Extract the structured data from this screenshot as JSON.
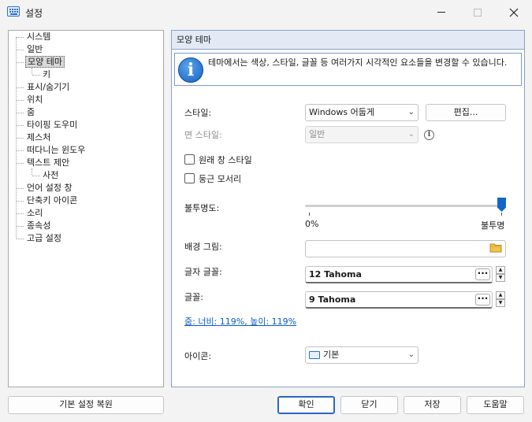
{
  "window": {
    "title": "설정"
  },
  "tree": {
    "items": [
      {
        "label": "시스템"
      },
      {
        "label": "일반"
      },
      {
        "label": "모양 테마",
        "selected": true
      },
      {
        "label": "키"
      },
      {
        "label": "표시/숨기기"
      },
      {
        "label": "위치"
      },
      {
        "label": "줌"
      },
      {
        "label": "타이핑 도우미"
      },
      {
        "label": "제스처"
      },
      {
        "label": "떠다니는 윈도우"
      },
      {
        "label": "텍스트 제안"
      },
      {
        "label": "사전"
      },
      {
        "label": "언어 설정 창"
      },
      {
        "label": "단축키 아이콘"
      },
      {
        "label": "소리"
      },
      {
        "label": "종속성"
      },
      {
        "label": "고급 설정"
      }
    ]
  },
  "panel": {
    "header": "모양 테마",
    "info_text": "테마에서는 색상, 스타일, 글꼴 등 여러가지 시각적인 요소들을 변경할 수 있습니다.",
    "style": {
      "label": "스타일:",
      "value": "Windows 어둡게",
      "edit_button": "편집..."
    },
    "face_style": {
      "label": "면 스타일:",
      "value": "일반"
    },
    "original_window_style": {
      "label": "원래 창 스타일",
      "checked": false
    },
    "rounded_corners": {
      "label": "둥근 모서리",
      "checked": false
    },
    "opacity": {
      "label": "불투명도:",
      "min_label": "0%",
      "max_label": "불투명",
      "value_percent": 100
    },
    "background_image": {
      "label": "배경 그림:",
      "value": ""
    },
    "key_font": {
      "label": "글자 글꼴:",
      "value": "12 Tahoma"
    },
    "font": {
      "label": "글꼴:",
      "value": "9 Tahoma"
    },
    "zoom_link": "줌: 너비: 119%, 높이: 119%",
    "icon": {
      "label": "아이콘:",
      "value": "기본"
    }
  },
  "footer": {
    "restore_defaults": "기본 설정 복원",
    "ok": "확인",
    "close": "닫기",
    "save": "저장",
    "help": "도움말"
  },
  "colors": {
    "accent": "#1366c9",
    "header_bg": "#e3eaf6",
    "link": "#0b5cc7"
  },
  "icons": [
    "keyboard-icon",
    "minimize-icon",
    "maximize-icon",
    "close-icon",
    "info-icon",
    "help-icon",
    "folder-icon"
  ]
}
